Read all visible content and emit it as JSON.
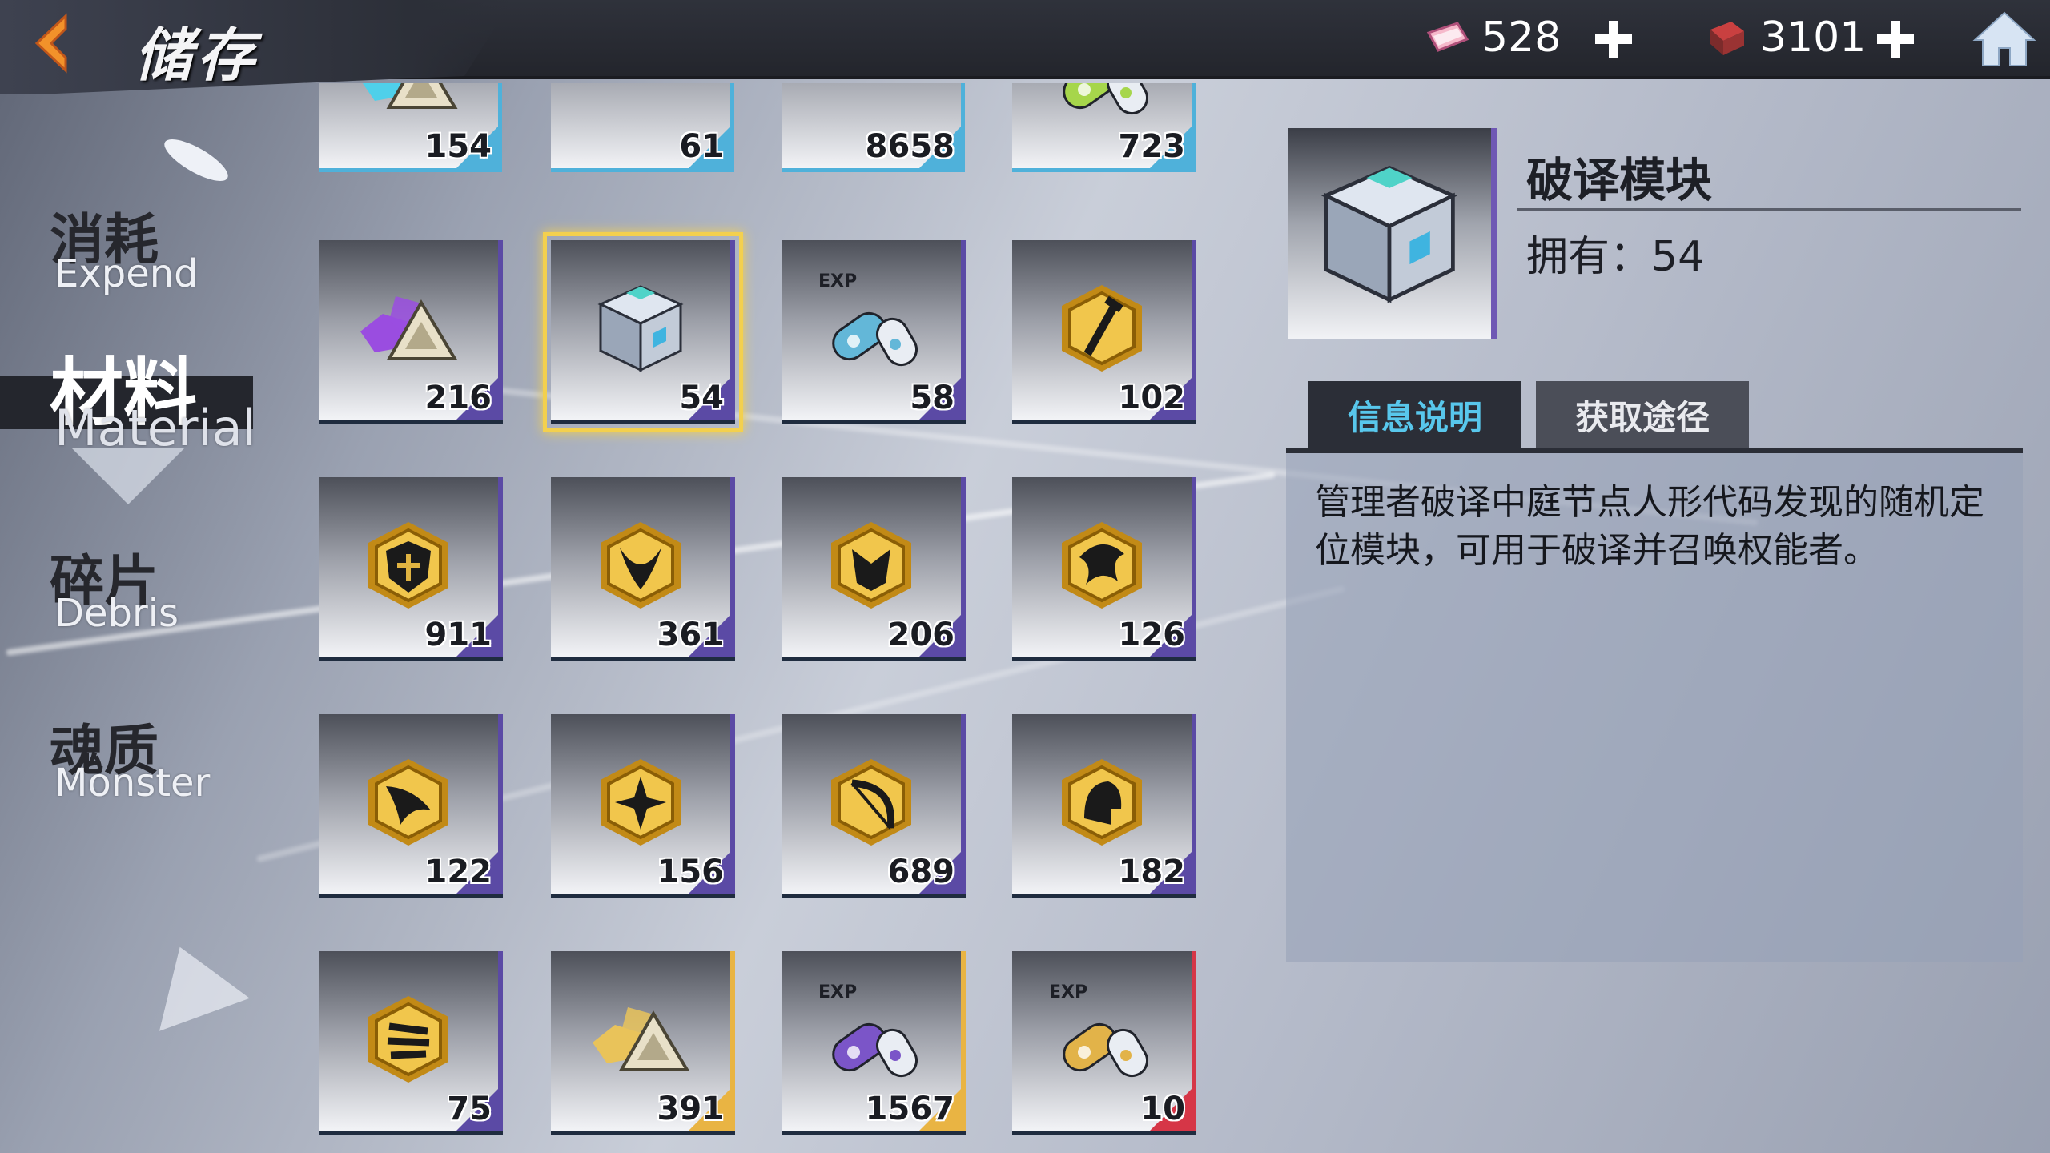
{
  "header": {
    "title": "储存",
    "currencies": [
      {
        "icon": "ticket-icon",
        "value": "528"
      },
      {
        "icon": "cube-chip-icon",
        "value": "3101"
      }
    ]
  },
  "nav": {
    "items": [
      {
        "cn": "消耗",
        "en": "Expend",
        "active": false
      },
      {
        "cn": "材料",
        "en": "Material",
        "active": true
      },
      {
        "cn": "碎片",
        "en": "Debris",
        "active": false
      },
      {
        "cn": "魂质",
        "en": "Monster",
        "active": false
      }
    ]
  },
  "inventory": {
    "items": [
      {
        "icon": "blue-crystal-triangle-icon",
        "count": "154",
        "rarity": "blue"
      },
      {
        "icon": "blue-diamond-icon",
        "count": "61",
        "rarity": "blue"
      },
      {
        "icon": "cyan-hexagon-icon",
        "count": "8658",
        "rarity": "blue"
      },
      {
        "icon": "green-exp-capsule-icon",
        "count": "723",
        "rarity": "blue"
      },
      {
        "icon": "purple-crystal-triangle-icon",
        "count": "216",
        "rarity": "purple"
      },
      {
        "icon": "decrypt-cube-icon",
        "count": "54",
        "rarity": "purple",
        "selected": true
      },
      {
        "icon": "blue-exp-capsule-icon",
        "count": "58",
        "rarity": "purple"
      },
      {
        "icon": "gold-hex-sword-icon",
        "count": "102",
        "rarity": "purple"
      },
      {
        "icon": "gold-hex-shield-icon",
        "count": "911",
        "rarity": "purple"
      },
      {
        "icon": "gold-hex-horns-icon",
        "count": "361",
        "rarity": "purple"
      },
      {
        "icon": "gold-hex-fox-icon",
        "count": "206",
        "rarity": "purple"
      },
      {
        "icon": "gold-hex-dragon-icon",
        "count": "126",
        "rarity": "purple"
      },
      {
        "icon": "gold-hex-wing-icon",
        "count": "122",
        "rarity": "purple"
      },
      {
        "icon": "gold-hex-star-icon",
        "count": "156",
        "rarity": "purple"
      },
      {
        "icon": "gold-hex-bow-icon",
        "count": "689",
        "rarity": "purple"
      },
      {
        "icon": "gold-hex-helmet-icon",
        "count": "182",
        "rarity": "purple"
      },
      {
        "icon": "gold-hex-claw-icon",
        "count": "75",
        "rarity": "purple"
      },
      {
        "icon": "gold-crystal-triangle-icon",
        "count": "391",
        "rarity": "gold"
      },
      {
        "icon": "purple-exp-capsule-icon",
        "count": "1567",
        "rarity": "gold"
      },
      {
        "icon": "gold-exp-capsule-icon",
        "count": "10",
        "rarity": "red"
      }
    ]
  },
  "detail": {
    "name": "破译模块",
    "owned_label": "拥有：",
    "owned_value": "54",
    "tabs": [
      "信息说明",
      "获取途径"
    ],
    "description": "管理者破译中庭节点人形代码发现的随机定位模块，可用于破译并召唤权能者。"
  },
  "colors": {
    "accent_cyan": "#58c7ec",
    "selected_gold": "#f3d04e",
    "rarity_purple": "#5b4aa5",
    "rarity_gold": "#e9b443",
    "rarity_red": "#d63647",
    "rarity_blue": "#4fb1da"
  }
}
